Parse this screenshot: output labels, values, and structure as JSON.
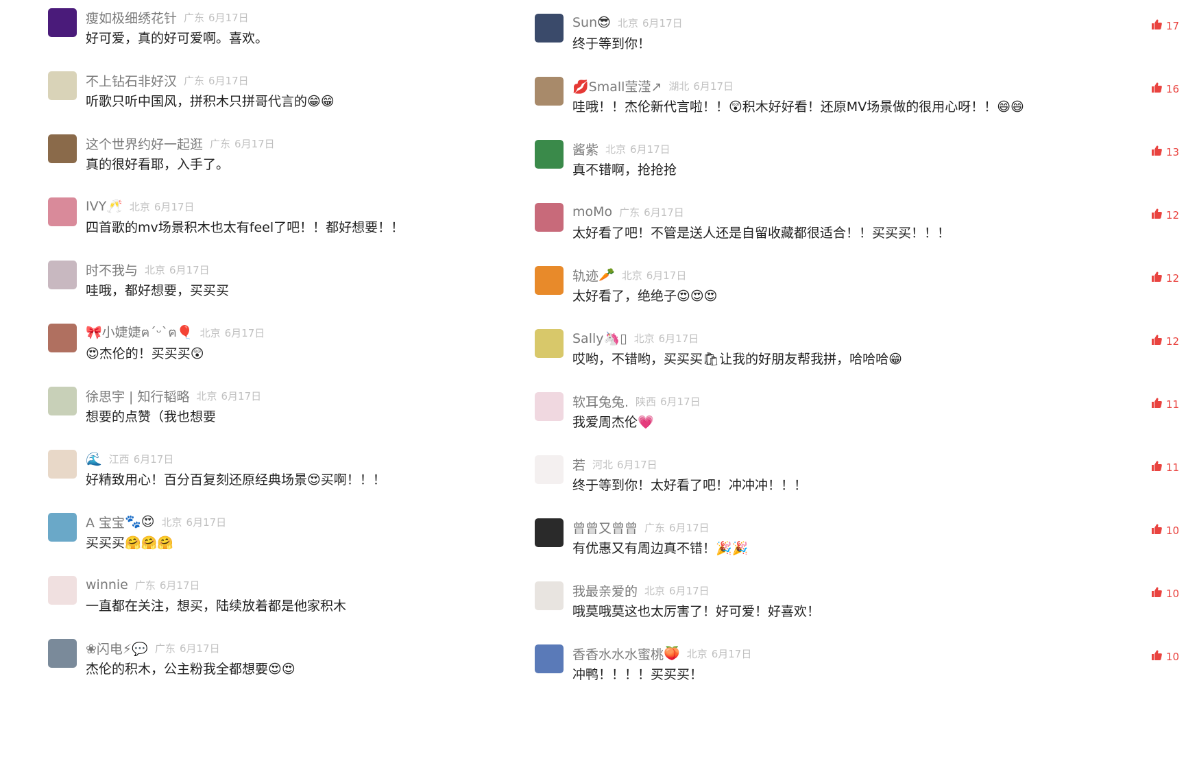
{
  "left_comments": [
    {
      "user": "瘦如极细绣花针",
      "user_emoji": "",
      "location": "广东",
      "date": "6月17日",
      "text": "好可爱，真的好可爱啊。喜欢。",
      "text_emoji": "",
      "avatar_color": "#4a1b7a"
    },
    {
      "user": "不上钻石非好汉",
      "user_emoji": "",
      "location": "广东",
      "date": "6月17日",
      "text": "听歌只听中国风，拼积木只拼哥代言的",
      "text_emoji": "😁😁",
      "avatar_color": "#d9d3b8"
    },
    {
      "user": "这个世界约好一起逛",
      "user_emoji": "",
      "location": "广东",
      "date": "6月17日",
      "text": "真的很好看耶，入手了。",
      "text_emoji": "",
      "avatar_color": "#8a6a4a"
    },
    {
      "user": "IVY",
      "user_emoji": "🥂",
      "location": "北京",
      "date": "6月17日",
      "text": "四首歌的mv场景积木也太有feel了吧！！都好想要！！",
      "text_emoji": "",
      "avatar_color": "#d98a9a"
    },
    {
      "user": "时不我与",
      "user_emoji": "",
      "location": "北京",
      "date": "6月17日",
      "text": "哇哦，都好想要，买买买",
      "text_emoji": "",
      "avatar_color": "#c8b8c0"
    },
    {
      "user": "🎀小婕婕ฅ´ᵕ`ฅ🎈",
      "user_emoji": "",
      "location": "北京",
      "date": "6月17日",
      "text": "😍杰伦的！买买买😲",
      "text_emoji": "",
      "avatar_color": "#b07060"
    },
    {
      "user": "徐思宇 | 知行韬略",
      "user_emoji": "",
      "location": "北京",
      "date": "6月17日",
      "text": "想要的点赞（我也想要",
      "text_emoji": "",
      "avatar_color": "#c8d0b8"
    },
    {
      "user": "🌊",
      "user_emoji": "",
      "location": "江西",
      "date": "6月17日",
      "text": "好精致用心！百分百复刻还原经典场景😍买啊！！！",
      "text_emoji": "",
      "avatar_color": "#e8d8c8"
    },
    {
      "user": "A 宝宝",
      "user_emoji": "🐾😍",
      "location": "北京",
      "date": "6月17日",
      "text": "买买买",
      "text_emoji": "🤗🤗🤗",
      "avatar_color": "#6aa8c8"
    },
    {
      "user": "winnie",
      "user_emoji": "",
      "location": "广东",
      "date": "6月17日",
      "text": "一直都在关注，想买，陆续放着都是他家积木",
      "text_emoji": "",
      "avatar_color": "#f0e0e0"
    },
    {
      "user": "❀闪电⚡💬",
      "user_emoji": "",
      "location": "广东",
      "date": "6月17日",
      "text": "杰伦的积木，公主粉我全都想要",
      "text_emoji": "😍😍",
      "avatar_color": "#7a8a9a"
    }
  ],
  "right_comments": [
    {
      "user": "Sun",
      "user_emoji": "😎",
      "location": "北京",
      "date": "6月17日",
      "text": "终于等到你！",
      "text_emoji": "",
      "likes": "17",
      "avatar_color": "#3a4a6a"
    },
    {
      "user": "💋Small莹滢↗",
      "user_emoji": "",
      "location": "湖北",
      "date": "6月17日",
      "text": "哇哦！！杰伦新代言啦！！😲积木好好看！还原MV场景做的很用心呀！！😄😄",
      "text_emoji": "",
      "likes": "16",
      "avatar_color": "#a88a6a"
    },
    {
      "user": "酱紫",
      "user_emoji": "",
      "location": "北京",
      "date": "6月17日",
      "text": "真不错啊，抢抢抢",
      "text_emoji": "",
      "likes": "13",
      "avatar_color": "#3a8a4a"
    },
    {
      "user": "moMo",
      "user_emoji": "",
      "location": "广东",
      "date": "6月17日",
      "text": "太好看了吧！不管是送人还是自留收藏都很适合！！买买买！！！",
      "text_emoji": "",
      "likes": "12",
      "avatar_color": "#c86a7a"
    },
    {
      "user": "轨迹",
      "user_emoji": "🥕",
      "location": "北京",
      "date": "6月17日",
      "text": "太好看了，绝绝子",
      "text_emoji": "😍😍😍",
      "likes": "12",
      "avatar_color": "#e88a2a"
    },
    {
      "user": "Sally🦄▯",
      "user_emoji": "",
      "location": "北京",
      "date": "6月17日",
      "text": "哎哟，不错哟，买买买🛍让我的好朋友帮我拼，哈哈哈😁",
      "text_emoji": "",
      "likes": "12",
      "avatar_color": "#d8c86a"
    },
    {
      "user": "软耳兔兔.",
      "user_emoji": "",
      "location": "陕西",
      "date": "6月17日",
      "text": "我爱周杰伦",
      "text_emoji": "💗",
      "likes": "11",
      "avatar_color": "#f0d8e0"
    },
    {
      "user": "若",
      "user_emoji": "",
      "location": "河北",
      "date": "6月17日",
      "text": "终于等到你！太好看了吧！冲冲冲！！！",
      "text_emoji": "",
      "likes": "11",
      "avatar_color": "#f4f0f0"
    },
    {
      "user": "曾曾又曾曾",
      "user_emoji": "",
      "location": "广东",
      "date": "6月17日",
      "text": "有优惠又有周边真不错！",
      "text_emoji": "🎉🎉",
      "likes": "10",
      "avatar_color": "#2a2a2a"
    },
    {
      "user": "我最亲爱的",
      "user_emoji": "",
      "location": "北京",
      "date": "6月17日",
      "text": "哦莫哦莫这也太厉害了！好可爱！好喜欢！",
      "text_emoji": "",
      "likes": "10",
      "avatar_color": "#e8e4e0"
    },
    {
      "user": "香香水水水蜜桃",
      "user_emoji": "🍑",
      "location": "北京",
      "date": "6月17日",
      "text": "冲鸭！！！！买买买！",
      "text_emoji": "",
      "likes": "10",
      "avatar_color": "#5a7ab8"
    }
  ],
  "colors": {
    "like": "#e9433f",
    "username": "#7a7a7a",
    "meta": "#c0c0c0",
    "text": "#222222"
  },
  "icons": {
    "like": "thumbs-up-icon"
  }
}
